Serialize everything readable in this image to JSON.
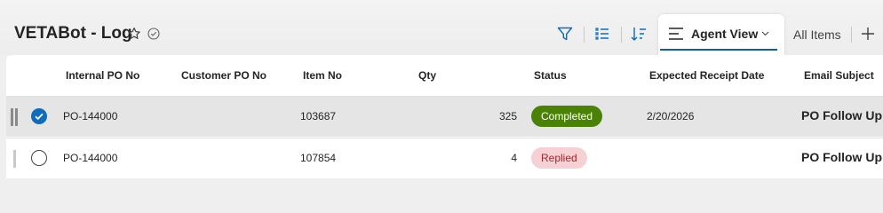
{
  "header": {
    "title": "VETABot - Log",
    "icons": [
      "star-icon",
      "check-circle-icon",
      "filter-icon",
      "checklist-icon",
      "sort-icon",
      "plus-icon"
    ],
    "tabs": [
      {
        "label": "Agent View",
        "active": true,
        "icon": "lines-icon"
      },
      {
        "label": "All Items",
        "active": false
      }
    ],
    "accent_color": "#115ea3"
  },
  "grid": {
    "columns": [
      "Internal PO No",
      "Customer PO No",
      "Item No",
      "Qty",
      "Status",
      "Expected Receipt Date",
      "Email Subject"
    ],
    "rows": [
      {
        "selected": true,
        "internal_po": "PO-144000",
        "customer_po": "",
        "item_no": "103687",
        "qty": "325",
        "status": "Completed",
        "status_bg": "#498205",
        "status_fg": "#ffffff",
        "expected_date": "2/20/2026",
        "email_subject": "PO Follow Up"
      },
      {
        "selected": false,
        "internal_po": "PO-144000",
        "customer_po": "",
        "item_no": "107854",
        "qty": "4",
        "status": "Replied",
        "status_bg": "#f6d1d3",
        "status_fg": "#a4262c",
        "expected_date": "",
        "email_subject": "PO Follow Up"
      }
    ]
  }
}
